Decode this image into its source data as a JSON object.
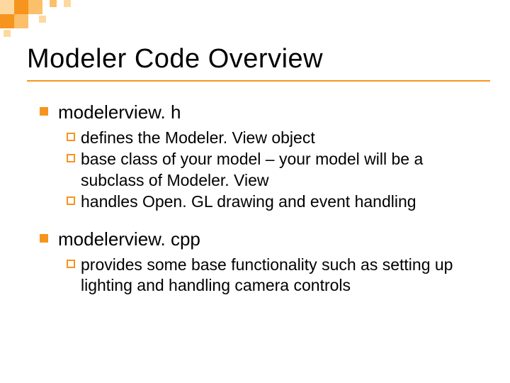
{
  "title": "Modeler Code Overview",
  "sections": [
    {
      "heading": "modelerview. h",
      "items": [
        "defines the Modeler. View object",
        "base class of your model – your model will be a subclass of Modeler. View",
        "handles Open. GL drawing and event handling"
      ]
    },
    {
      "heading": "modelerview. cpp",
      "items": [
        "provides some base functionality such as setting up lighting and handling camera controls"
      ]
    }
  ]
}
